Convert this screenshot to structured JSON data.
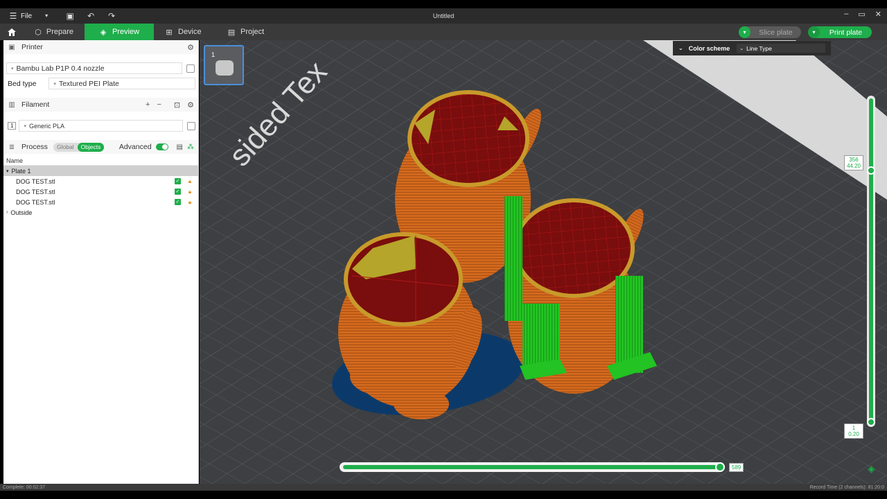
{
  "titlebar": {
    "file_label": "File",
    "window_title": "Untitled"
  },
  "nav": {
    "tabs": [
      {
        "label": "Prepare",
        "icon": "cube-icon"
      },
      {
        "label": "Preview",
        "icon": "layers-icon"
      },
      {
        "label": "Device",
        "icon": "device-icon"
      },
      {
        "label": "Project",
        "icon": "project-icon"
      }
    ],
    "slice_label": "Slice plate",
    "print_label": "Print plate"
  },
  "sidebar": {
    "printer": {
      "heading": "Printer",
      "printer_value": "Bambu Lab P1P 0.4 nozzle",
      "bed_type_label": "Bed type",
      "bed_type_value": "Textured PEI Plate"
    },
    "filament": {
      "heading": "Filament",
      "slot": "1",
      "value": "Generic PLA"
    },
    "process": {
      "heading": "Process",
      "global_label": "Global",
      "objects_label": "Objects",
      "advanced_label": "Advanced"
    },
    "tree": {
      "column_name": "Name",
      "plate_label": "Plate 1",
      "objects": [
        "DOG TEST.stl",
        "DOG TEST.stl",
        "DOG TEST.stl"
      ],
      "outside_label": "Outside"
    }
  },
  "viewport": {
    "plate_number": "1",
    "color_scheme_label": "Color scheme",
    "color_scheme_value": "Line Type",
    "bed_text": "sided Tex",
    "layer_top_index": "356",
    "layer_top_height": "44.20",
    "layer_bottom_index": "1",
    "layer_bottom_height": "0.20",
    "move_value": "589",
    "colors": {
      "accent": "#1eae4b",
      "wall": "#d2691e",
      "infill": "#7a0d0d",
      "support": "#22c322",
      "brim": "#0b3a6a",
      "top_surface": "#b5a52a"
    }
  },
  "status": {
    "left": "Complete: 00:02:37",
    "right": "Record Time (2 channels): 81:20:0"
  }
}
